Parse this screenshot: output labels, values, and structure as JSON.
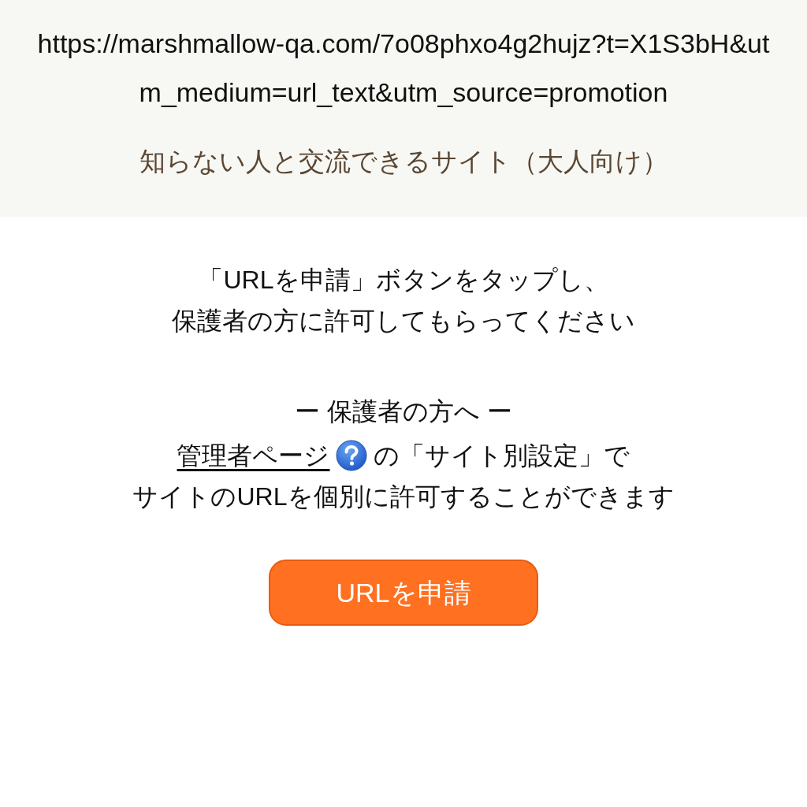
{
  "header": {
    "url": "https://marshmallow-qa.com/7o08phxo4g2hujz?t=X1S3bH&utm_medium=url_text&utm_source=promotion",
    "site_title": "知らない人と交流できるサイト（大人向け）"
  },
  "instruction": {
    "lines": [
      "「URLを申請」ボタンをタップし、",
      "保護者の方に許可してもらってください"
    ]
  },
  "guardian_note": {
    "heading": "ー 保護者の方へ ー",
    "link": "管理者ページ",
    "lines": [
      "の「サイト別設定」で",
      "サイトのURLを個別に許可することができます"
    ]
  },
  "button": {
    "label": "URLを申請"
  }
}
